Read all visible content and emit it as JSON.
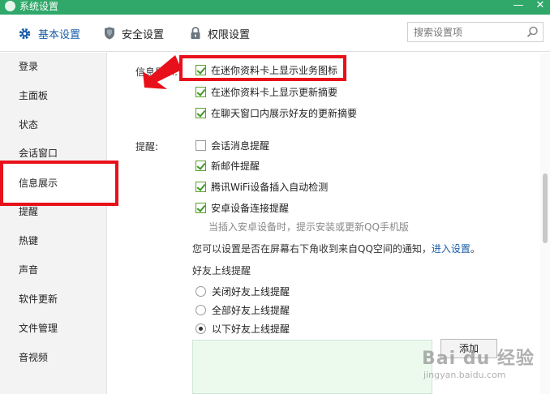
{
  "window": {
    "title": "系统设置",
    "minimize_glyph": "—",
    "close_glyph": "✕"
  },
  "tabs": [
    {
      "label": "基本设置",
      "icon": "gear-icon",
      "active": true
    },
    {
      "label": "安全设置",
      "icon": "shield-icon",
      "active": false
    },
    {
      "label": "权限设置",
      "icon": "lock-icon",
      "active": false
    }
  ],
  "search": {
    "placeholder": "搜索设置项",
    "value": ""
  },
  "sidebar": {
    "items": [
      {
        "label": "登录"
      },
      {
        "label": "主面板"
      },
      {
        "label": "状态"
      },
      {
        "label": "会话窗口"
      },
      {
        "label": "信息展示",
        "selected": true
      },
      {
        "label": "提醒"
      },
      {
        "label": "热键"
      },
      {
        "label": "声音"
      },
      {
        "label": "软件更新"
      },
      {
        "label": "文件管理"
      },
      {
        "label": "音视频"
      }
    ]
  },
  "info_display": {
    "label": "信息展示:",
    "options": [
      {
        "label": "在迷你资料卡上显示业务图标",
        "checked": true
      },
      {
        "label": "在迷你资料卡上显示更新摘要",
        "checked": true
      },
      {
        "label": "在聊天窗口内展示好友的更新摘要",
        "checked": true
      }
    ]
  },
  "reminders": {
    "label": "提醒:",
    "options": [
      {
        "label": "会话消息提醒",
        "checked": false
      },
      {
        "label": "新邮件提醒",
        "checked": true
      },
      {
        "label": "腾讯WiFi设备插入自动检测",
        "checked": true
      },
      {
        "label": "安卓设备连接提醒",
        "checked": true
      }
    ],
    "android_hint": "当插入安卓设备时，提示安装或更新QQ手机版",
    "qzone_notice": "您可以设置是否在屏幕右下角收到来自QQ空间的通知，",
    "qzone_link": "进入设置",
    "qzone_end": "。"
  },
  "friend_online": {
    "title": "好友上线提醒",
    "options": [
      {
        "label": "关闭好友上线提醒",
        "checked": false
      },
      {
        "label": "全部好友上线提醒",
        "checked": false
      },
      {
        "label": "以下好友上线提醒",
        "checked": true
      }
    ],
    "add_button": "添加"
  },
  "watermark": {
    "main": "Bai du 经验",
    "sub": "jingyan.baidu.com"
  },
  "colors": {
    "titlebar": "#2fa86a",
    "accent_link": "#1a5ea8",
    "highlight_red": "#e8101a",
    "check_green": "#3d9a22",
    "list_bg": "#ecfaee"
  }
}
